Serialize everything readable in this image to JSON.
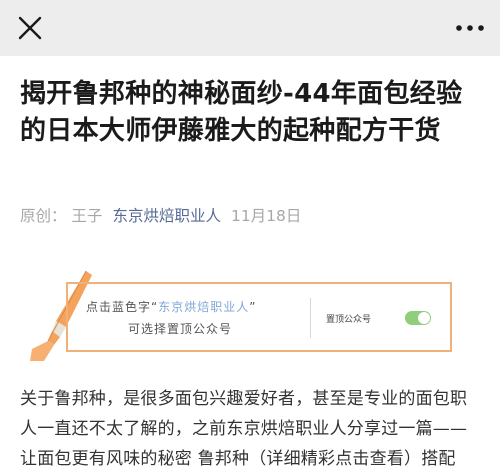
{
  "header": {
    "close_icon": "close-icon",
    "more_icon": "more-dots-icon"
  },
  "article": {
    "title": "揭开鲁邦种的神秘面纱-44年面包经验的日本大师伊藤雅大的起种配方干货",
    "author": "原创： 王子",
    "account": "东京烘焙职业人",
    "date": "11月18日"
  },
  "banner": {
    "prefix": "点击蓝色字“",
    "highlight": "东京烘焙职业人",
    "suffix": "”",
    "line2": "可选择置顶公众号",
    "pin_label": "置顶公众号",
    "toggle_on": true,
    "accent_color": "#f0b078",
    "toggle_color": "#8fce7a"
  },
  "body": {
    "lines": [
      "关于鲁邦种，是很多面包兴趣爱好者，甚至是专业的面包职",
      "人一直还不太了解的，之前东京烘焙职业人分享过一篇——",
      "让面包更有风味的秘密 鲁邦种（详细精彩点击查看）搭配"
    ]
  },
  "colors": {
    "topbar": "#ededed",
    "link": "#576b95",
    "meta_gray": "#a8a8a8"
  }
}
